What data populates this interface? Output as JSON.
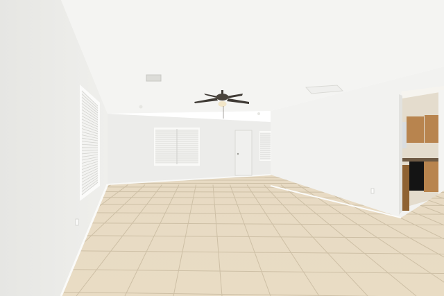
{
  "scene": {
    "colors": {
      "ceiling": "#f4f4f2",
      "left_wall": "#e6e6e3",
      "back_wall": "#ececea",
      "right_wall": "#f2f2f0",
      "floor": "#e9dcc4",
      "floor_grout": "#cdbfa5",
      "baseboard": "#fafaf8",
      "window_glass": "#f3f3f1",
      "blind_slat": "#d4d4d0",
      "door": "#f0f0ee",
      "cabinet": "#b8844e",
      "cabinet_dark": "#8f6232",
      "appliance": "#141414",
      "fan_blade": "#3f3a35",
      "fan_light": "#f2e6c8"
    },
    "icons": [
      "ceiling-fan-icon",
      "air-vent-icon",
      "electrical-outlet-icon"
    ]
  }
}
